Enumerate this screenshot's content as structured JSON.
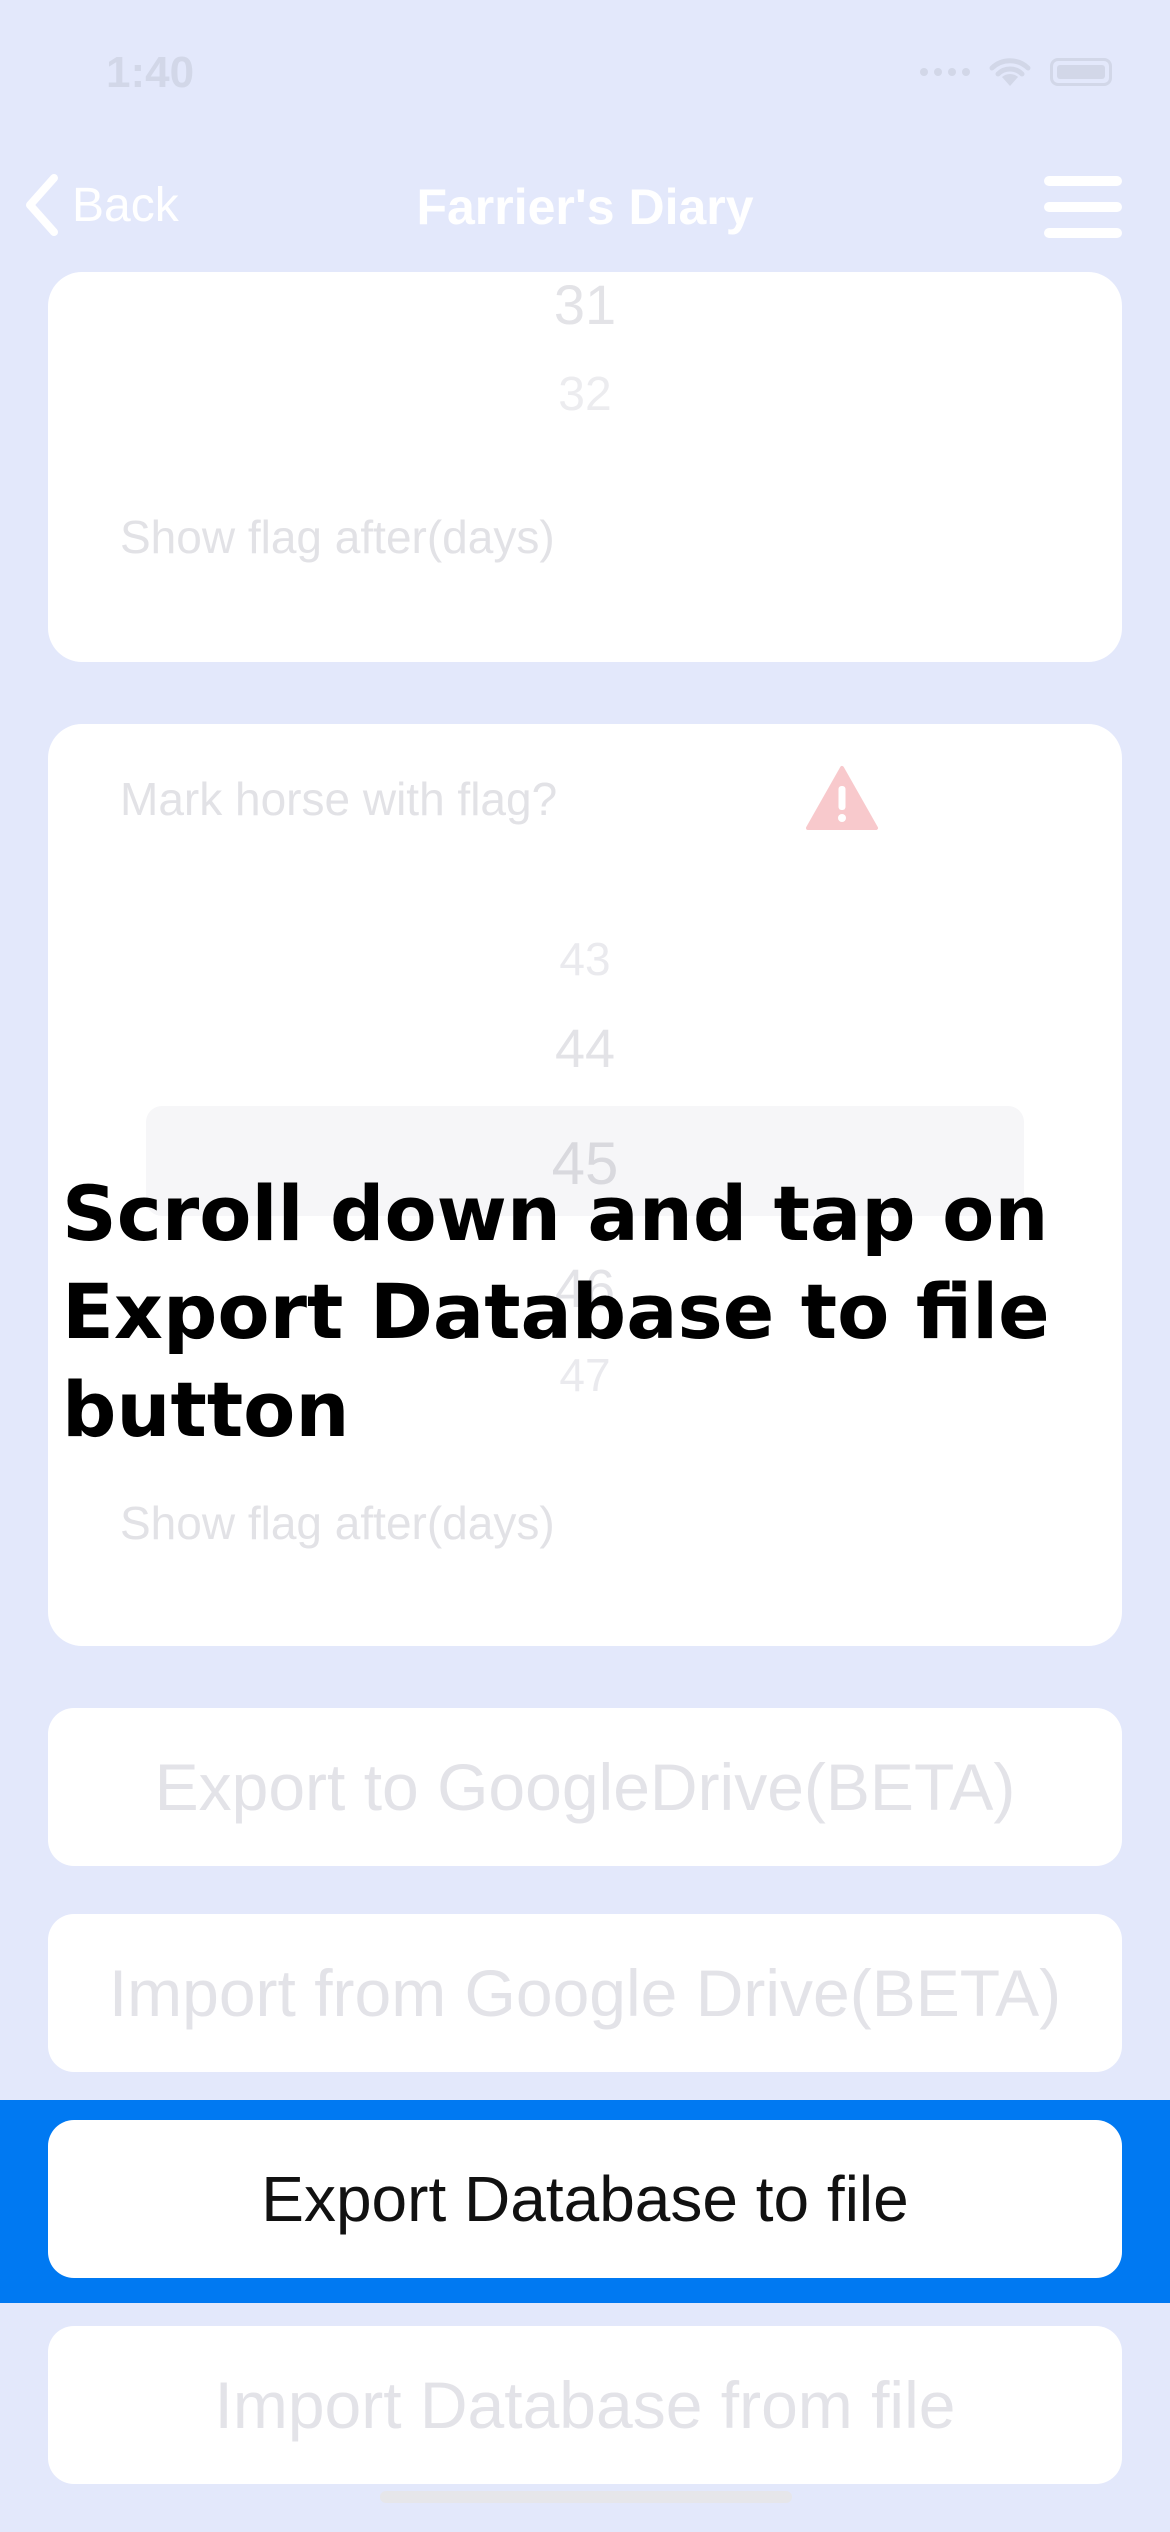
{
  "status_bar": {
    "time": "1:40"
  },
  "nav": {
    "back_label": "Back",
    "title": "Farrier's Diary"
  },
  "card1": {
    "picker_values": [
      "31",
      "32"
    ],
    "show_flag_label": "Show flag after(days)"
  },
  "card2": {
    "mark_flag_label": "Mark horse with flag?",
    "picker_values": [
      "43",
      "44",
      "45",
      "46",
      "47"
    ],
    "show_flag_label": "Show flag after(days)"
  },
  "buttons": {
    "export_google": "Export to GoogleDrive(BETA)",
    "import_google": "Import from Google Drive(BETA)",
    "export_db": "Export Database to file",
    "import_db": "Import Database from file"
  },
  "instruction": "Scroll down and tap on Export Database to file button",
  "colors": {
    "background": "#e3e8fb",
    "highlight": "#0079f2",
    "warning": "#f8c9cc"
  }
}
